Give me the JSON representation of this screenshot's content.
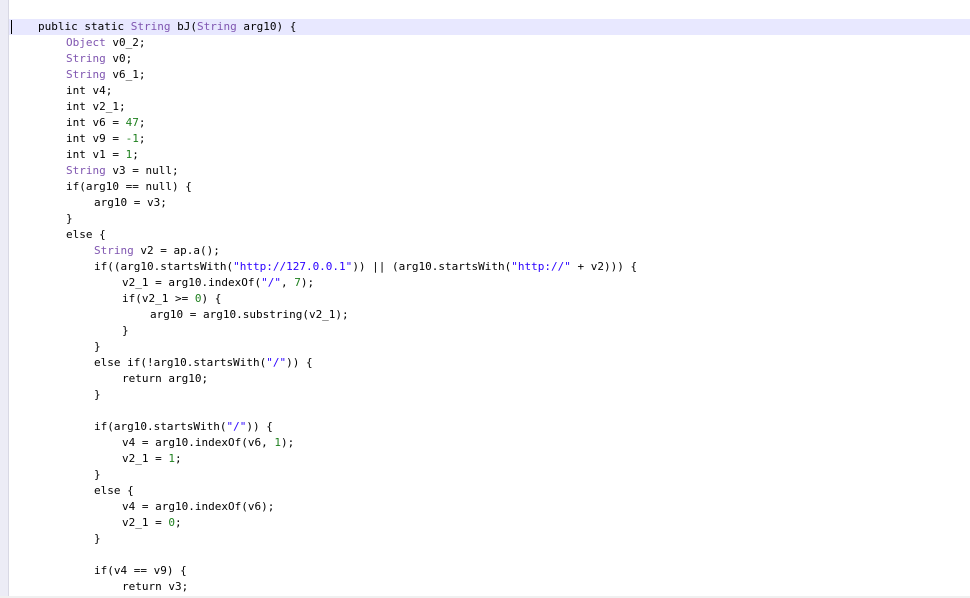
{
  "editor": {
    "lines": [
      {
        "indent": 0,
        "tokens": [
          [
            "kw",
            "public static "
          ],
          [
            "ty",
            "String"
          ],
          [
            "op",
            " bJ("
          ],
          [
            "ty",
            "String"
          ],
          [
            "op",
            " arg10) {"
          ]
        ]
      },
      {
        "indent": 1,
        "tokens": [
          [
            "ty",
            "Object"
          ],
          [
            "op",
            " v0_2;"
          ]
        ]
      },
      {
        "indent": 1,
        "tokens": [
          [
            "ty",
            "String"
          ],
          [
            "op",
            " v0;"
          ]
        ]
      },
      {
        "indent": 1,
        "tokens": [
          [
            "ty",
            "String"
          ],
          [
            "op",
            " v6_1;"
          ]
        ]
      },
      {
        "indent": 1,
        "tokens": [
          [
            "kw",
            "int"
          ],
          [
            "op",
            " v4;"
          ]
        ]
      },
      {
        "indent": 1,
        "tokens": [
          [
            "kw",
            "int"
          ],
          [
            "op",
            " v2_1;"
          ]
        ]
      },
      {
        "indent": 1,
        "tokens": [
          [
            "kw",
            "int"
          ],
          [
            "op",
            " v6 = "
          ],
          [
            "num",
            "47"
          ],
          [
            "op",
            ";"
          ]
        ]
      },
      {
        "indent": 1,
        "tokens": [
          [
            "kw",
            "int"
          ],
          [
            "op",
            " v9 = "
          ],
          [
            "num",
            "-1"
          ],
          [
            "op",
            ";"
          ]
        ]
      },
      {
        "indent": 1,
        "tokens": [
          [
            "kw",
            "int"
          ],
          [
            "op",
            " v1 = "
          ],
          [
            "num",
            "1"
          ],
          [
            "op",
            ";"
          ]
        ]
      },
      {
        "indent": 1,
        "tokens": [
          [
            "ty",
            "String"
          ],
          [
            "op",
            " v3 = "
          ],
          [
            "kw",
            "null"
          ],
          [
            "op",
            ";"
          ]
        ]
      },
      {
        "indent": 1,
        "tokens": [
          [
            "kw",
            "if"
          ],
          [
            "op",
            "(arg10 == "
          ],
          [
            "kw",
            "null"
          ],
          [
            "op",
            ") {"
          ]
        ]
      },
      {
        "indent": 2,
        "tokens": [
          [
            "op",
            "arg10 = v3;"
          ]
        ]
      },
      {
        "indent": 1,
        "tokens": [
          [
            "op",
            "}"
          ]
        ]
      },
      {
        "indent": 1,
        "tokens": [
          [
            "kw",
            "else"
          ],
          [
            "op",
            " {"
          ]
        ]
      },
      {
        "indent": 2,
        "tokens": [
          [
            "ty",
            "String"
          ],
          [
            "op",
            " v2 = ap.a();"
          ]
        ]
      },
      {
        "indent": 2,
        "tokens": [
          [
            "kw",
            "if"
          ],
          [
            "op",
            "((arg10.startsWith("
          ],
          [
            "str",
            "\"http://127.0.0.1\""
          ],
          [
            "op",
            ")) || (arg10.startsWith("
          ],
          [
            "str",
            "\"http://\""
          ],
          [
            "op",
            " + v2))) {"
          ]
        ]
      },
      {
        "indent": 3,
        "tokens": [
          [
            "op",
            "v2_1 = arg10.indexOf("
          ],
          [
            "str",
            "\"/\""
          ],
          [
            "op",
            ", "
          ],
          [
            "num",
            "7"
          ],
          [
            "op",
            ");"
          ]
        ]
      },
      {
        "indent": 3,
        "tokens": [
          [
            "kw",
            "if"
          ],
          [
            "op",
            "(v2_1 >= "
          ],
          [
            "num",
            "0"
          ],
          [
            "op",
            ") {"
          ]
        ]
      },
      {
        "indent": 4,
        "tokens": [
          [
            "op",
            "arg10 = arg10.substring(v2_1);"
          ]
        ]
      },
      {
        "indent": 3,
        "tokens": [
          [
            "op",
            "}"
          ]
        ]
      },
      {
        "indent": 2,
        "tokens": [
          [
            "op",
            "}"
          ]
        ]
      },
      {
        "indent": 2,
        "tokens": [
          [
            "kw",
            "else if"
          ],
          [
            "op",
            "(!arg10.startsWith("
          ],
          [
            "str",
            "\"/\""
          ],
          [
            "op",
            ")) {"
          ]
        ]
      },
      {
        "indent": 3,
        "tokens": [
          [
            "kw",
            "return"
          ],
          [
            "op",
            " arg10;"
          ]
        ]
      },
      {
        "indent": 2,
        "tokens": [
          [
            "op",
            "}"
          ]
        ]
      },
      {
        "indent": 0,
        "tokens": []
      },
      {
        "indent": 2,
        "tokens": [
          [
            "kw",
            "if"
          ],
          [
            "op",
            "(arg10.startsWith("
          ],
          [
            "str",
            "\"/\""
          ],
          [
            "op",
            ")) {"
          ]
        ]
      },
      {
        "indent": 3,
        "tokens": [
          [
            "op",
            "v4 = arg10.indexOf(v6, "
          ],
          [
            "num",
            "1"
          ],
          [
            "op",
            ");"
          ]
        ]
      },
      {
        "indent": 3,
        "tokens": [
          [
            "op",
            "v2_1 = "
          ],
          [
            "num",
            "1"
          ],
          [
            "op",
            ";"
          ]
        ]
      },
      {
        "indent": 2,
        "tokens": [
          [
            "op",
            "}"
          ]
        ]
      },
      {
        "indent": 2,
        "tokens": [
          [
            "kw",
            "else"
          ],
          [
            "op",
            " {"
          ]
        ]
      },
      {
        "indent": 3,
        "tokens": [
          [
            "op",
            "v4 = arg10.indexOf(v6);"
          ]
        ]
      },
      {
        "indent": 3,
        "tokens": [
          [
            "op",
            "v2_1 = "
          ],
          [
            "num",
            "0"
          ],
          [
            "op",
            ";"
          ]
        ]
      },
      {
        "indent": 2,
        "tokens": [
          [
            "op",
            "}"
          ]
        ]
      },
      {
        "indent": 0,
        "tokens": []
      },
      {
        "indent": 2,
        "tokens": [
          [
            "kw",
            "if"
          ],
          [
            "op",
            "(v4 == v9) {"
          ]
        ]
      },
      {
        "indent": 3,
        "tokens": [
          [
            "kw",
            "return"
          ],
          [
            "op",
            " v3;"
          ]
        ]
      }
    ]
  }
}
